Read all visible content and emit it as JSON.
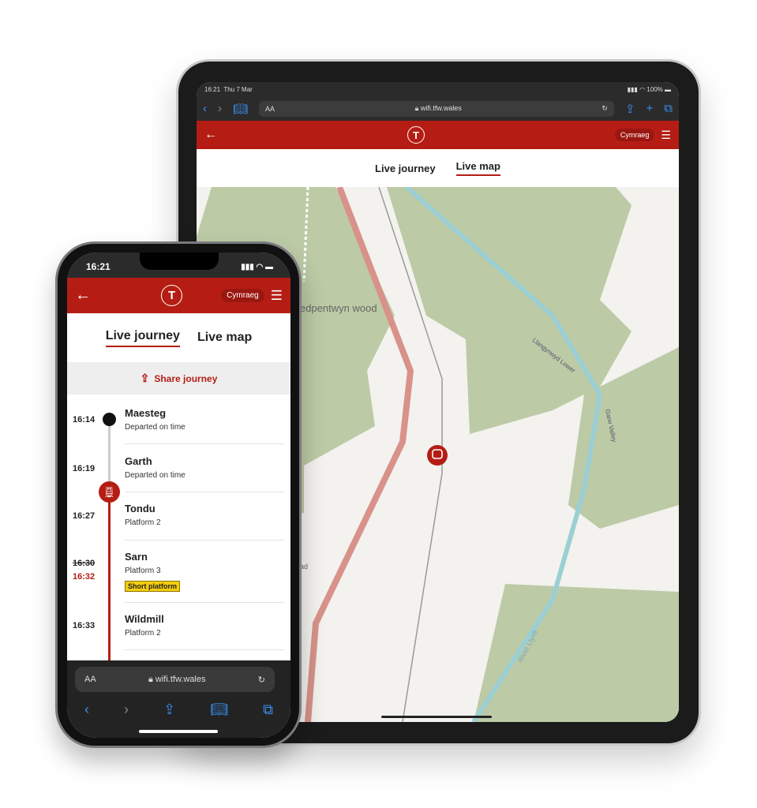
{
  "tablet": {
    "status": {
      "time": "16:21",
      "date": "Thu 7 Mar",
      "battery": "100%"
    },
    "browser": {
      "text_size": "AA",
      "url": "wifi.tfw.wales"
    },
    "header": {
      "language_button": "Cymraeg"
    },
    "tabs": [
      {
        "label": "Live journey",
        "active": false
      },
      {
        "label": "Live map",
        "active": true
      }
    ],
    "map": {
      "labels": {
        "wood": "edpentwyn wood",
        "road1": "Llangynwyd Lower",
        "road2": "Garw Valley",
        "river": "River Llynfi",
        "road3": "ad"
      }
    }
  },
  "phone": {
    "status": {
      "time": "16:21"
    },
    "header": {
      "language_button": "Cymraeg"
    },
    "tabs": [
      {
        "label": "Live journey",
        "active": true
      },
      {
        "label": "Live map",
        "active": false
      }
    ],
    "share_label": "Share journey",
    "stops": [
      {
        "time": "16:14",
        "name": "Maesteg",
        "detail": "Departed on time"
      },
      {
        "time": "16:19",
        "name": "Garth",
        "detail": "Departed on time"
      },
      {
        "time": "16:27",
        "name": "Tondu",
        "detail": "Platform 2"
      },
      {
        "time": "16:30",
        "expected": "16:32",
        "name": "Sarn",
        "detail": "Platform 3",
        "badge": "Short platform"
      },
      {
        "time": "16:33",
        "name": "Wildmill",
        "detail": "Platform 2"
      }
    ],
    "browser": {
      "text_size": "AA",
      "url": "wifi.tfw.wales"
    }
  },
  "colors": {
    "brand_red": "#b51d14",
    "badge_yellow": "#f4cd0e",
    "ios_blue": "#3a8ff0"
  }
}
